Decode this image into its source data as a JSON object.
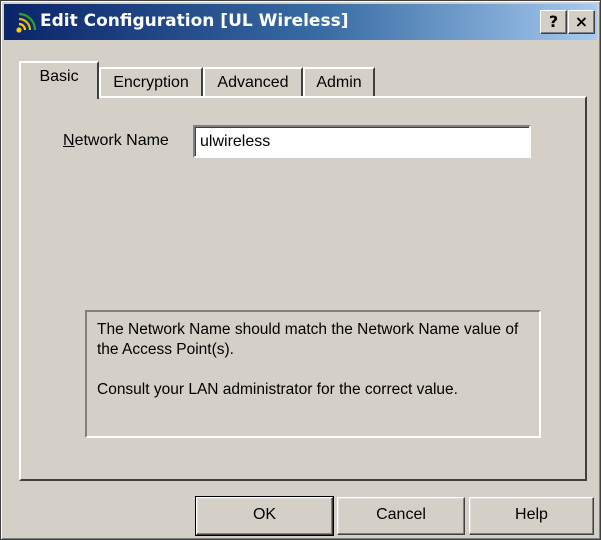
{
  "window": {
    "title": "Edit Configuration [UL Wireless]",
    "help_button": "?",
    "close_button": "×"
  },
  "tabs": [
    {
      "label": "Basic",
      "active": true
    },
    {
      "label": "Encryption",
      "active": false
    },
    {
      "label": "Advanced",
      "active": false
    },
    {
      "label": "Admin",
      "active": false
    }
  ],
  "basic": {
    "network_name_label_mnemonic": "N",
    "network_name_label_rest": "etwork Name",
    "network_name_value": "ulwireless",
    "info_line_1": "The Network Name should match the Network Name value of the Access Point(s).",
    "info_line_2": "Consult your LAN administrator for the correct value."
  },
  "buttons": {
    "ok": "OK",
    "cancel": "Cancel",
    "help": "Help"
  },
  "colors": {
    "title_gradient_start": "#0a246a",
    "title_gradient_end": "#a6caf0",
    "face": "#d4d0c8"
  }
}
